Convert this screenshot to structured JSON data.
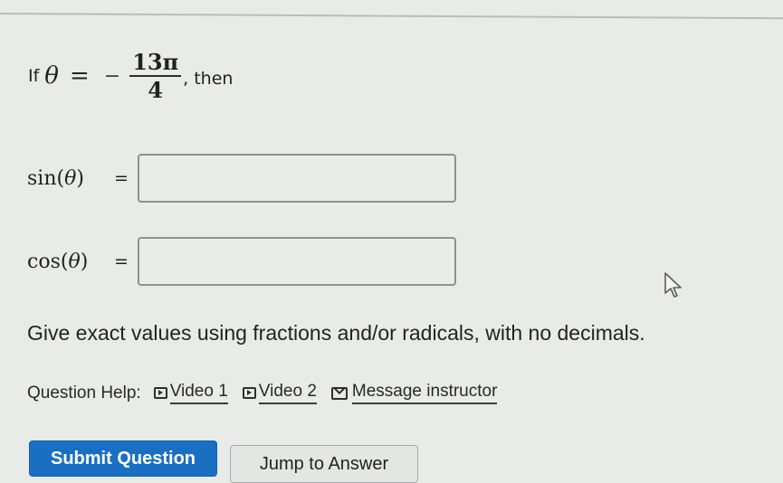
{
  "question": {
    "prefix": "If",
    "variable": "θ",
    "equals": "=",
    "sign": "−",
    "numerator": "13π",
    "denominator": "4",
    "suffix": ", then"
  },
  "fields": [
    {
      "func": "sin",
      "open": "(",
      "var": "θ",
      "close": ")",
      "equals": "=",
      "value": "",
      "placeholder": ""
    },
    {
      "func": "cos",
      "open": "(",
      "var": "θ",
      "close": ")",
      "equals": "=",
      "value": "",
      "placeholder": ""
    }
  ],
  "instructions": "Give exact values using fractions and/or radicals, with no decimals.",
  "help": {
    "label": "Question Help:",
    "links": [
      {
        "label": "Video 1",
        "icon": "play-icon"
      },
      {
        "label": "Video 2",
        "icon": "play-icon"
      },
      {
        "label": "Message instructor",
        "icon": "mail-icon"
      }
    ]
  },
  "buttons": {
    "submit": "Submit Question",
    "jump": "Jump to Answer"
  },
  "colors": {
    "primary": "#1a6fc2",
    "background": "#e8ebe8"
  }
}
